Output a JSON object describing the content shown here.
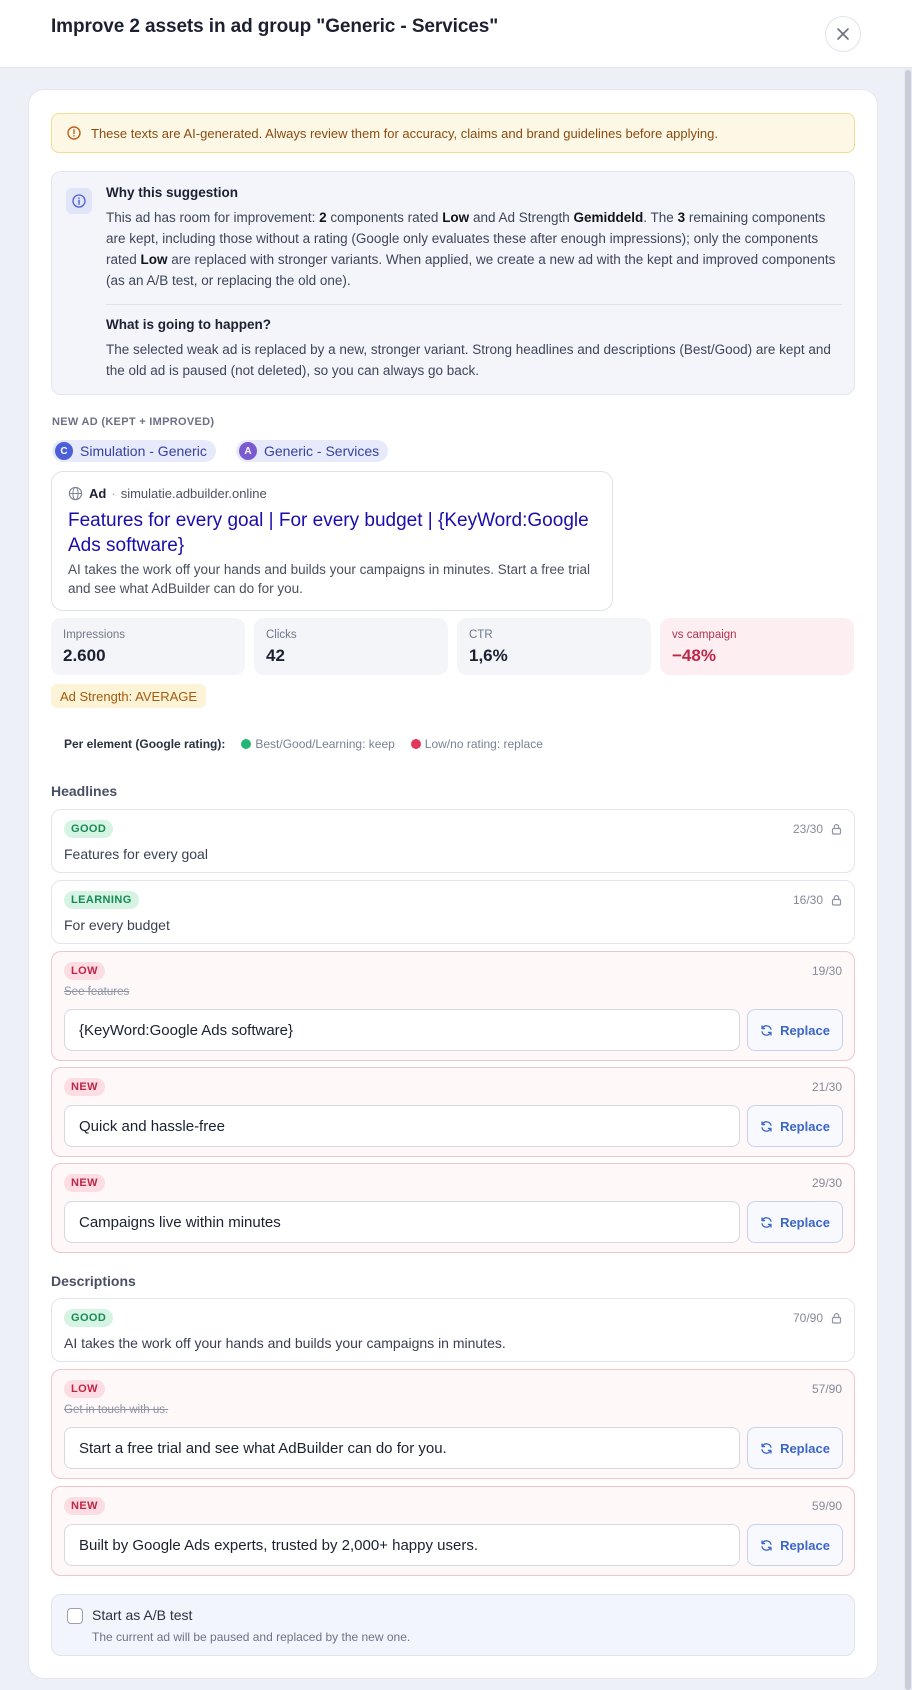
{
  "header": {
    "title": "Improve 2 assets in ad group \"Generic - Services\""
  },
  "warning": "These texts are AI-generated. Always review them for accuracy, claims and brand guidelines before applying.",
  "why": {
    "title": "Why this suggestion",
    "p1_a": "This ad has room for improvement: ",
    "p1_n1": "2",
    "p1_b": " components rated ",
    "p1_low1": "Low",
    "p1_c": " and Ad Strength ",
    "p1_strength": "Gemiddeld",
    "p1_d": ". The ",
    "p1_n2": "3",
    "p1_e": " remaining components are kept, including those without a rating (Google only evaluates these after enough impressions); only the components rated ",
    "p1_low2": "Low",
    "p1_f": " are replaced with stronger variants. When applied, we create a new ad with the kept and improved components (as an A/B test, or replacing the old one).",
    "title2": "What is going to happen?",
    "p2": "The selected weak ad is replaced by a new, stronger variant. Strong headlines and descriptions (Best/Good) are kept and the old ad is paused (not deleted), so you can always go back."
  },
  "new_ad": {
    "section_label": "NEW AD (KEPT + IMPROVED)",
    "campaign": {
      "letter": "C",
      "name": "Simulation - Generic",
      "color": "#4a5fd8"
    },
    "adgroup": {
      "letter": "A",
      "name": "Generic - Services",
      "color": "#7a5ad0"
    },
    "preview": {
      "ad_label": "Ad",
      "domain": "simulatie.adbuilder.online",
      "headline": "Features for every goal | For every budget | {KeyWord:Google Ads software}",
      "description": "AI takes the work off your hands and builds your campaigns in minutes. Start a free trial and see what AdBuilder can do for you."
    }
  },
  "stats": [
    {
      "label": "Impressions",
      "value": "2.600"
    },
    {
      "label": "Clicks",
      "value": "42"
    },
    {
      "label": "CTR",
      "value": "1,6%"
    },
    {
      "label": "vs campaign",
      "value": "−48%"
    }
  ],
  "ad_strength": "Ad Strength: AVERAGE",
  "legend": {
    "title": "Per element (Google rating):",
    "keep": "Best/Good/Learning: keep",
    "replace": "Low/no rating: replace"
  },
  "headlines": {
    "title": "Headlines",
    "items": [
      {
        "badge": "GOOD",
        "count": "23/30",
        "text": "Features for every goal"
      },
      {
        "badge": "LEARNING",
        "count": "16/30",
        "text": "For every budget"
      },
      {
        "badge": "LOW",
        "count": "19/30",
        "old": "See features",
        "value": "{KeyWord:Google Ads software}",
        "button": "Replace"
      },
      {
        "badge": "NEW",
        "count": "21/30",
        "value": "Quick and hassle-free",
        "button": "Replace"
      },
      {
        "badge": "NEW",
        "count": "29/30",
        "value": "Campaigns live within minutes",
        "button": "Replace"
      }
    ]
  },
  "descriptions": {
    "title": "Descriptions",
    "items": [
      {
        "badge": "GOOD",
        "count": "70/90",
        "text": "AI takes the work off your hands and builds your campaigns in minutes."
      },
      {
        "badge": "LOW",
        "count": "57/90",
        "old": "Get in touch with us.",
        "value": "Start a free trial and see what AdBuilder can do for you.",
        "button": "Replace"
      },
      {
        "badge": "NEW",
        "count": "59/90",
        "value": "Built by Google Ads experts, trusted by 2,000+ happy users.",
        "button": "Replace"
      }
    ]
  },
  "abtest": {
    "label": "Start as A/B test",
    "hint": "The current ad will be paused and replaced by the new one.",
    "checked": false
  }
}
